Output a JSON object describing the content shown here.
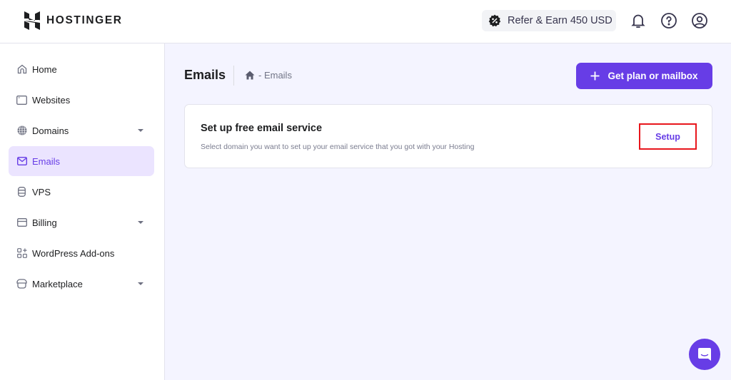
{
  "header": {
    "brand": "HOSTINGER",
    "refer_label": "Refer & Earn 450 USD",
    "icons": [
      "bell-icon",
      "help-icon",
      "account-icon"
    ]
  },
  "sidebar": {
    "items": [
      {
        "label": "Home",
        "icon": "home-icon",
        "active": false,
        "expandable": false
      },
      {
        "label": "Websites",
        "icon": "browser-window-icon",
        "active": false,
        "expandable": false
      },
      {
        "label": "Domains",
        "icon": "globe-icon",
        "active": false,
        "expandable": true
      },
      {
        "label": "Emails",
        "icon": "envelope-icon",
        "active": true,
        "expandable": false
      },
      {
        "label": "VPS",
        "icon": "database-icon",
        "active": false,
        "expandable": false
      },
      {
        "label": "Billing",
        "icon": "credit-card-icon",
        "active": false,
        "expandable": true
      },
      {
        "label": "WordPress Add-ons",
        "icon": "add-ons-grid-icon",
        "active": false,
        "expandable": false
      },
      {
        "label": "Marketplace",
        "icon": "store-icon",
        "active": false,
        "expandable": true
      }
    ]
  },
  "main": {
    "title": "Emails",
    "breadcrumb": "- Emails",
    "primary_button": "Get plan or mailbox",
    "card": {
      "title": "Set up free email service",
      "description": "Select domain you want to set up your email service that you got with your Hosting",
      "button": "Setup"
    }
  },
  "colors": {
    "accent": "#673de6",
    "highlight_border": "#e8161c",
    "active_bg": "#ebe4ff",
    "page_bg": "#f4f4ff"
  }
}
